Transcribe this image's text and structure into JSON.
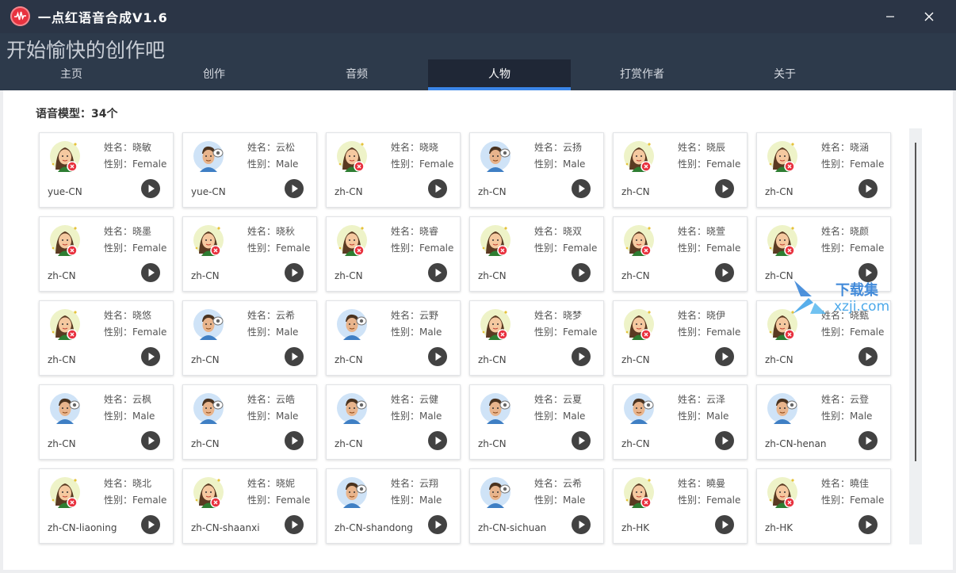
{
  "window": {
    "title": "一点红语音合成V1.6"
  },
  "header": {
    "slogan": "开始愉快的创作吧"
  },
  "tabs": [
    {
      "label": "主页",
      "active": false
    },
    {
      "label": "创作",
      "active": false
    },
    {
      "label": "音频",
      "active": false
    },
    {
      "label": "人物",
      "active": true
    },
    {
      "label": "打赏作者",
      "active": false
    },
    {
      "label": "关于",
      "active": false
    }
  ],
  "content": {
    "model_count_label": "语音模型：34个"
  },
  "watermark": {
    "line1": "下载集",
    "line2": "xzji.com"
  },
  "colors": {
    "accent": "#3b86e8",
    "female_avatar_bg": "#eef3c8",
    "male_avatar_bg": "#cfe3f7",
    "badge": "#e8323f"
  },
  "characters": [
    {
      "name": "姓名：晓敏",
      "gender": "性别：Female",
      "lang": "yue-CN",
      "avatar": "female-avatar-icon"
    },
    {
      "name": "姓名：云松",
      "gender": "性别：Male",
      "lang": "yue-CN",
      "avatar": "male-avatar-icon"
    },
    {
      "name": "姓名：晓晓",
      "gender": "性别：Female",
      "lang": "zh-CN",
      "avatar": "female-avatar-icon"
    },
    {
      "name": "姓名：云扬",
      "gender": "性别：Male",
      "lang": "zh-CN",
      "avatar": "male-avatar-icon"
    },
    {
      "name": "姓名：晓辰",
      "gender": "性别：Female",
      "lang": "zh-CN",
      "avatar": "female-avatar-icon"
    },
    {
      "name": "姓名：晓涵",
      "gender": "性别：Female",
      "lang": "zh-CN",
      "avatar": "female-avatar-icon"
    },
    {
      "name": "姓名：晓墨",
      "gender": "性别：Female",
      "lang": "zh-CN",
      "avatar": "female-avatar-icon"
    },
    {
      "name": "姓名：晓秋",
      "gender": "性别：Female",
      "lang": "zh-CN",
      "avatar": "female-avatar-icon"
    },
    {
      "name": "姓名：晓睿",
      "gender": "性别：Female",
      "lang": "zh-CN",
      "avatar": "female-avatar-icon"
    },
    {
      "name": "姓名：晓双",
      "gender": "性别：Female",
      "lang": "zh-CN",
      "avatar": "female-avatar-icon"
    },
    {
      "name": "姓名：晓萱",
      "gender": "性别：Female",
      "lang": "zh-CN",
      "avatar": "female-avatar-icon"
    },
    {
      "name": "姓名：晓颜",
      "gender": "性别：Female",
      "lang": "zh-CN",
      "avatar": "female-avatar-icon"
    },
    {
      "name": "姓名：晓悠",
      "gender": "性别：Female",
      "lang": "zh-CN",
      "avatar": "female-avatar-icon"
    },
    {
      "name": "姓名：云希",
      "gender": "性别：Male",
      "lang": "zh-CN",
      "avatar": "male-avatar-icon"
    },
    {
      "name": "姓名：云野",
      "gender": "性别：Male",
      "lang": "zh-CN",
      "avatar": "male-avatar-icon"
    },
    {
      "name": "姓名：晓梦",
      "gender": "性别：Female",
      "lang": "zh-CN",
      "avatar": "female-avatar-icon"
    },
    {
      "name": "姓名：晓伊",
      "gender": "性别：Female",
      "lang": "zh-CN",
      "avatar": "female-avatar-icon"
    },
    {
      "name": "姓名：晓甄",
      "gender": "性别：Female",
      "lang": "zh-CN",
      "avatar": "female-avatar-icon"
    },
    {
      "name": "姓名：云枫",
      "gender": "性别：Male",
      "lang": "zh-CN",
      "avatar": "male-avatar-icon"
    },
    {
      "name": "姓名：云皓",
      "gender": "性别：Male",
      "lang": "zh-CN",
      "avatar": "male-avatar-icon"
    },
    {
      "name": "姓名：云健",
      "gender": "性别：Male",
      "lang": "zh-CN",
      "avatar": "male-avatar-icon"
    },
    {
      "name": "姓名：云夏",
      "gender": "性别：Male",
      "lang": "zh-CN",
      "avatar": "male-avatar-icon"
    },
    {
      "name": "姓名：云泽",
      "gender": "性别：Male",
      "lang": "zh-CN",
      "avatar": "male-avatar-icon"
    },
    {
      "name": "姓名：云登",
      "gender": "性别：Male",
      "lang": "zh-CN-henan",
      "avatar": "male-avatar-icon"
    },
    {
      "name": "姓名：晓北",
      "gender": "性别：Female",
      "lang": "zh-CN-liaoning",
      "avatar": "female-avatar-icon"
    },
    {
      "name": "姓名：晓妮",
      "gender": "性别：Female",
      "lang": "zh-CN-shaanxi",
      "avatar": "female-avatar-icon"
    },
    {
      "name": "姓名：云翔",
      "gender": "性别：Male",
      "lang": "zh-CN-shandong",
      "avatar": "male-avatar-icon"
    },
    {
      "name": "姓名：云希",
      "gender": "性别：Male",
      "lang": "zh-CN-sichuan",
      "avatar": "male-avatar-icon"
    },
    {
      "name": "姓名：曉曼",
      "gender": "性别：Female",
      "lang": "zh-HK",
      "avatar": "female-avatar-icon"
    },
    {
      "name": "姓名：曉佳",
      "gender": "性别：Female",
      "lang": "zh-HK",
      "avatar": "female-avatar-icon"
    }
  ]
}
